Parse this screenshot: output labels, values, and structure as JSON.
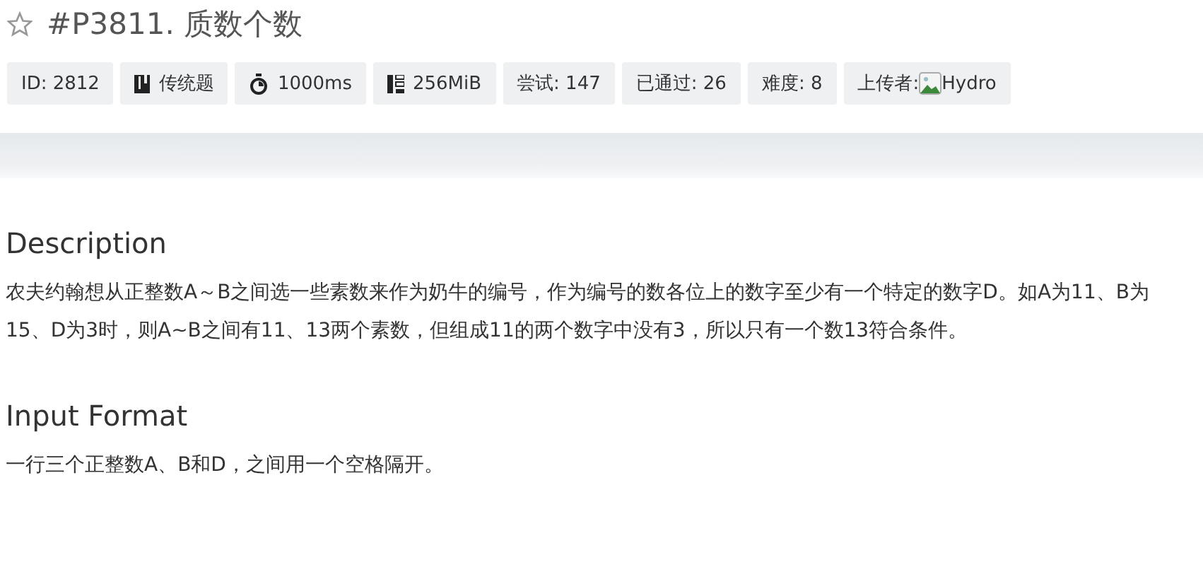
{
  "title": {
    "starred": false,
    "text": "#P3811. 质数个数"
  },
  "badges": [
    {
      "kind": "plain",
      "text": "ID: 2812"
    },
    {
      "kind": "type",
      "text": "传统题"
    },
    {
      "kind": "time",
      "text": "1000ms"
    },
    {
      "kind": "memory",
      "text": "256MiB"
    },
    {
      "kind": "plain",
      "text": "尝试: 147"
    },
    {
      "kind": "plain",
      "text": "已通过: 26"
    },
    {
      "kind": "plain",
      "text": "难度: 8"
    },
    {
      "kind": "uploader",
      "text": "上传者:",
      "name": "Hydro"
    }
  ],
  "sections": [
    {
      "heading": "Description",
      "body": "农夫约翰想从正整数A～B之间选一些素数来作为奶牛的编号，作为编号的数各位上的数字至少有一个特定的数字D。如A为11、B为15、D为3时，则A~B之间有11、13两个素数，但组成11的两个数字中没有3，所以只有一个数13符合条件。"
    },
    {
      "heading": "Input Format",
      "body": "一行三个正整数A、B和D，之间用一个空格隔开。"
    }
  ]
}
